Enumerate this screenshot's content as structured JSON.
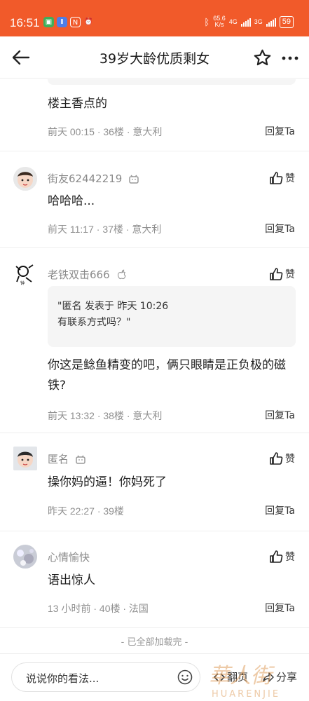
{
  "status_bar": {
    "time": "16:51",
    "speed_value": "65.6",
    "speed_unit": "K/s",
    "network_1": "4G",
    "network_2": "3G",
    "battery": "59"
  },
  "header": {
    "title": "39岁大龄优质剩女"
  },
  "comments": [
    {
      "text": "楼主香点的",
      "meta": "前天 00:15 · 36楼 · 意大利",
      "reply_label": "回复Ta"
    },
    {
      "username": "街友62442219",
      "like_label": "赞",
      "text": "哈哈哈...",
      "meta": "前天 11:17 · 37楼 · 意大利",
      "reply_label": "回复Ta"
    },
    {
      "username": "老铁双击666",
      "like_label": "赞",
      "quote_line1": "\"匿名 发表于 昨天 10:26",
      "quote_line2": "有联系方式吗？\"",
      "text": "你这是鲶鱼精变的吧，俩只眼睛是正负极的磁铁?",
      "meta": "前天 13:32 · 38楼 · 意大利",
      "reply_label": "回复Ta"
    },
    {
      "username": "匿名",
      "like_label": "赞",
      "text": "操你妈的逼！你妈死了",
      "meta": "昨天 22:27 · 39楼",
      "reply_label": "回复Ta"
    },
    {
      "username": "心情愉快",
      "like_label": "赞",
      "text": "语出惊人",
      "meta": "13 小时前 · 40楼 · 法国",
      "reply_label": "回复Ta"
    }
  ],
  "footer": {
    "loaded_all": "- 已全部加载完 -",
    "input_placeholder": "说说你的看法...",
    "page_label": "翻页",
    "share_label": "分享",
    "watermark": "華人街 HUARENJIE"
  },
  "colors": {
    "status_bar": "#f15a2a",
    "meta_text": "#8f8f8f"
  }
}
